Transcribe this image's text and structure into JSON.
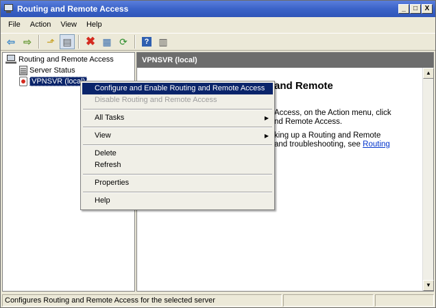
{
  "window": {
    "title": "Routing and Remote Access",
    "controls": {
      "minimize": "_",
      "maximize": "□",
      "close": "X"
    }
  },
  "menubar": {
    "items": [
      {
        "label": "File"
      },
      {
        "label": "Action"
      },
      {
        "label": "View"
      },
      {
        "label": "Help"
      }
    ]
  },
  "toolbar": {
    "buttons": [
      {
        "icon": "back-arrow-icon",
        "glyph": "⇦"
      },
      {
        "icon": "forward-arrow-icon",
        "glyph": "⇨"
      },
      {
        "icon": "up-folder-icon",
        "glyph": "⬏"
      },
      {
        "icon": "show-hide-tree-icon",
        "glyph": "▤"
      },
      {
        "icon": "delete-icon",
        "glyph": "✖"
      },
      {
        "icon": "properties-icon",
        "glyph": "▦"
      },
      {
        "icon": "refresh-icon",
        "glyph": "⟳"
      },
      {
        "icon": "help-icon",
        "glyph": "?"
      },
      {
        "icon": "view-icon",
        "glyph": "▥"
      }
    ]
  },
  "tree": {
    "root": {
      "label": "Routing and Remote Access",
      "icon": "computer-icon"
    },
    "children": [
      {
        "label": "Server Status",
        "icon": "server-status-icon"
      },
      {
        "label": "VPNSVR (local)",
        "icon": "server-local-icon",
        "selected": true
      }
    ]
  },
  "right_pane": {
    "header": "VPNSVR (local)",
    "heading_visible": "and Remote",
    "para1_line1": "Access, on the Action menu, click",
    "para1_line2": "nd Remote Access.",
    "para2_line1": "king up a Routing and Remote",
    "para2_line2_text": "and troubleshooting, see ",
    "para2_link": "Routing"
  },
  "context_menu": {
    "items": [
      {
        "label": "Configure and Enable Routing and Remote Access",
        "state": "highlighted"
      },
      {
        "label": "Disable Routing and Remote Access",
        "state": "disabled"
      },
      {
        "label": "All Tasks",
        "submenu": true
      },
      {
        "label": "View",
        "submenu": true
      },
      {
        "label": "Delete"
      },
      {
        "label": "Refresh"
      },
      {
        "label": "Properties"
      },
      {
        "label": "Help"
      }
    ],
    "submenu_glyph": "▶"
  },
  "statusbar": {
    "text": "Configures Routing and Remote Access for the selected server"
  },
  "colors": {
    "titlebar": "#3b63c8",
    "selection": "#0a246a",
    "header_bg": "#6d6d6d",
    "link": "#0033cc"
  }
}
